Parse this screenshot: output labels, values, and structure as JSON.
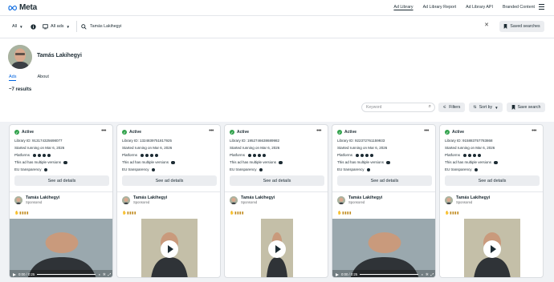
{
  "header": {
    "logo_text": "Meta",
    "nav": [
      {
        "label": "Ad Library",
        "active": true
      },
      {
        "label": "Ad Library Report",
        "active": false
      },
      {
        "label": "Ad Library API",
        "active": false
      },
      {
        "label": "Branded Content",
        "active": false
      }
    ]
  },
  "search": {
    "country": "All",
    "category": "All ads",
    "query": "Tamás Lakihegyi",
    "saved_label": "Saved searches"
  },
  "profile": {
    "name": "Tamás Lakihegyi",
    "tabs": [
      "Ads",
      "About"
    ],
    "results": "~7 results"
  },
  "toolbar": {
    "keyword_placeholder": "Keyword",
    "filters_label": "Filters",
    "sort_label": "Sort by",
    "save_search_label": "Save search"
  },
  "cards": [
    {
      "status": "Active",
      "library_id": "Library ID: 913174325698077",
      "started": "Started running on Mar 6, 2026",
      "platforms_label": "Platforms",
      "versions": "This ad has multiple versions",
      "eu": "EU transparency",
      "details_label": "See ad details",
      "advertiser": "Tamás Lakihegyi",
      "sponsored": "Sponsored",
      "time": "0:00 / 0:25",
      "has_controls": true
    },
    {
      "status": "Active",
      "library_id": "Library ID: 1324839751817925",
      "started": "Started running on Mar 6, 2026",
      "platforms_label": "Platforms",
      "versions": "This ad has multiple versions",
      "eu": "EU transparency",
      "details_label": "See ad details",
      "advertiser": "Tamás Lakihegyi",
      "sponsored": "Sponsored",
      "time": "",
      "has_controls": false
    },
    {
      "status": "Active",
      "library_id": "Library ID: 1952746638689982",
      "started": "Started running on Mar 6, 2026",
      "platforms_label": "Platforms",
      "versions": "This ad has multiple versions",
      "eu": "EU transparency",
      "details_label": "See ad details",
      "advertiser": "Tamás Lakihegyi",
      "sponsored": "Sponsored",
      "time": "",
      "has_controls": false
    },
    {
      "status": "Active",
      "library_id": "Library ID: 922372761159933",
      "started": "Started running on Mar 6, 2026",
      "platforms_label": "Platforms",
      "versions": "This ad has multiple versions",
      "eu": "EU transparency",
      "details_label": "See ad details",
      "advertiser": "Tamás Lakihegyi",
      "sponsored": "Sponsored",
      "time": "0:00 / 0:25",
      "has_controls": true
    },
    {
      "status": "Active",
      "library_id": "Library ID: 915883757783868",
      "started": "Started running on Mar 6, 2026",
      "platforms_label": "Platforms",
      "versions": "This ad has multiple versions",
      "eu": "EU transparency",
      "details_label": "See ad details",
      "advertiser": "Tamás Lakihegyi",
      "sponsored": "Sponsored",
      "time": "",
      "has_controls": false
    }
  ],
  "colors": {
    "accent": "#0064e0",
    "active_green": "#31a24c"
  }
}
